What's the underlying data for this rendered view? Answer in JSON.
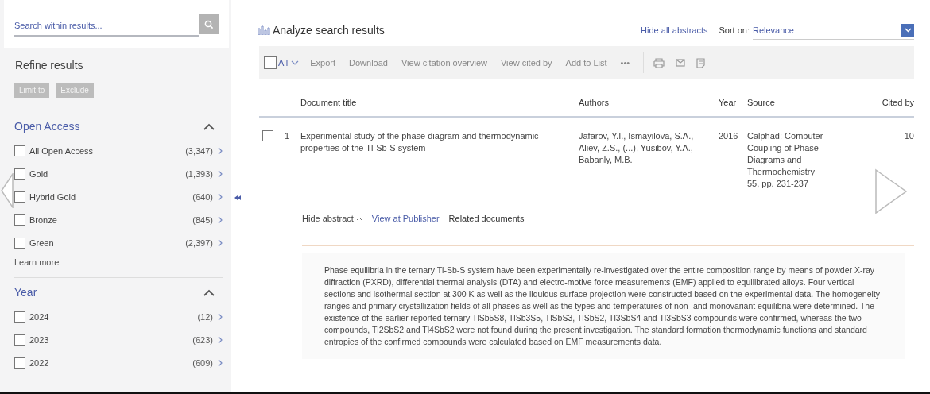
{
  "search": {
    "placeholder": "Search within results..."
  },
  "refine": {
    "title": "Refine results",
    "buttons": [
      "Limit to",
      "Exclude"
    ]
  },
  "facets": [
    {
      "title": "Open Access",
      "expanded": true,
      "link": "Learn more",
      "items": [
        {
          "label": "All Open Access",
          "count": "(3,347)",
          "checked": false
        },
        {
          "label": "Gold",
          "count": "(1,393)",
          "checked": false
        },
        {
          "label": "Hybrid Gold",
          "count": "(640)",
          "checked": false
        },
        {
          "label": "Bronze",
          "count": "(845)",
          "checked": false
        },
        {
          "label": "Green",
          "count": "(2,397)",
          "checked": false
        }
      ]
    },
    {
      "title": "Year",
      "expanded": true,
      "items": [
        {
          "label": "2024",
          "count": "(12)",
          "checked": false
        },
        {
          "label": "2023",
          "count": "(623)",
          "checked": false
        },
        {
          "label": "2022",
          "count": "(609)",
          "checked": false
        }
      ]
    }
  ],
  "header": {
    "analyze": "Analyze search results",
    "hide_all": "Hide all abstracts",
    "sort_label": "Sort on:",
    "sort_value": "Relevance"
  },
  "toolbar": {
    "select_all": {
      "label": "All",
      "checked": false
    },
    "actions": [
      "Export",
      "Download",
      "View citation overview",
      "View cited by",
      "Add to List",
      "•••"
    ]
  },
  "table": {
    "columns": [
      "Document title",
      "Authors",
      "Year",
      "Source",
      "Cited by"
    ],
    "rows": [
      {
        "number": "1",
        "checked": false,
        "title": "Experimental study of the phase diagram and thermodynamic properties of the Tl-Sb-S system",
        "authors": "Jafarov, Y.I., Ismayilova, S.A., Aliev, Z.S., (...), Yusibov, Y.A., Babanly, M.B.",
        "year": "2016",
        "source": "Calphad: Computer Coupling of Phase Diagrams and Thermochemistry",
        "source_detail": "55, pp. 231-237",
        "cited_by": "10",
        "links": [
          {
            "kind": "toggle",
            "label": "Hide abstract"
          },
          {
            "kind": "link",
            "label": "View at Publisher"
          },
          {
            "kind": "plain",
            "label": "Related documents"
          }
        ],
        "abstract": "Phase equilibria in the ternary Tl-Sb-S system have been experimentally re-investigated over the entire composition range by means of powder X-ray diffraction (PXRD), differential thermal analysis (DTA) and electro-motive force measurements (EMF) applied to equilibrated alloys. Four vertical sections and isothermal section at 300 K as well as the liquidus surface projection were constructed based on the experimental data. The homogeneity ranges and primary crystallization fields of all phases as well as the types and temperatures of non- and monovariant equilibria were determined. The existence of the earlier reported ternary TlSb5S8, TlSb3S5, TlSbS3, TlSbS2, Tl3SbS4 and Tl3SbS3 compounds were confirmed, whereas the two compounds, Tl2SbS2 and Tl4SbS2 were not found during the present investigation. The standard formation thermodynamic functions and standard entropies of the confirmed compounds were calculated based on EMF measurements data."
      }
    ]
  }
}
